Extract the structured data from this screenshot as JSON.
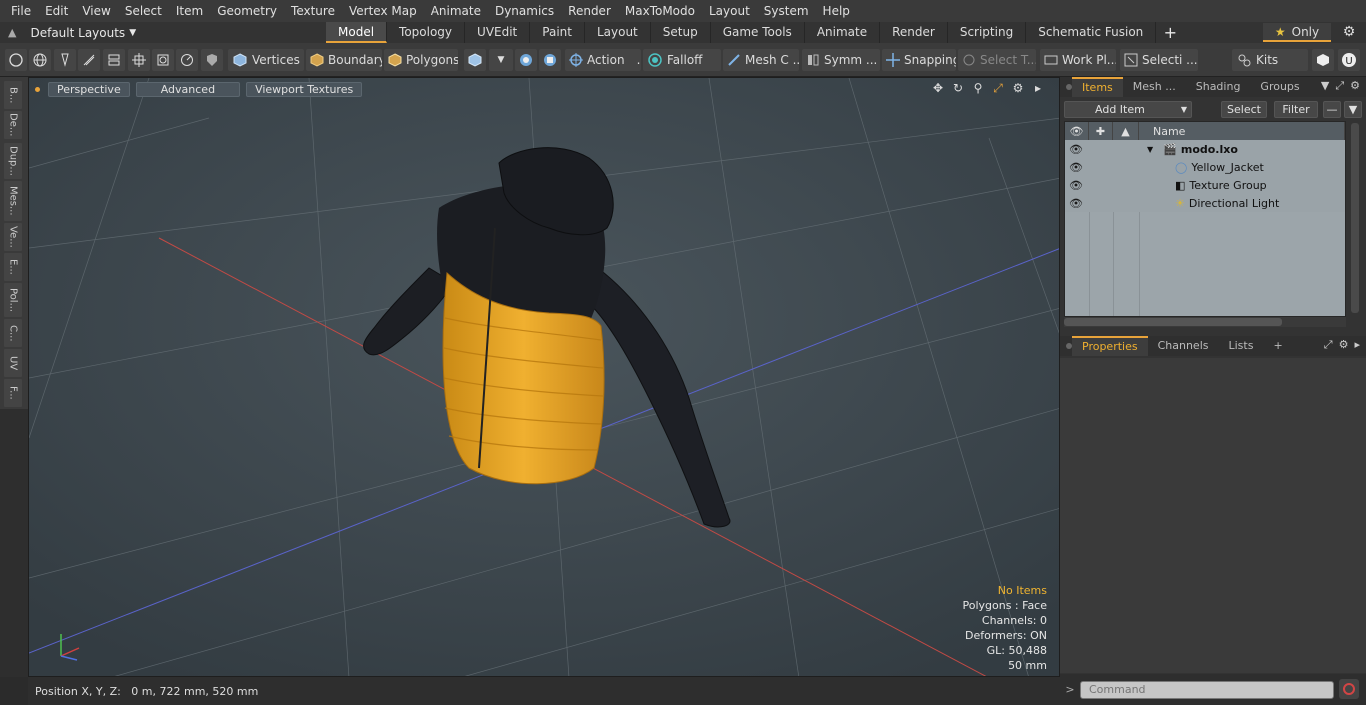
{
  "menu": [
    "File",
    "Edit",
    "View",
    "Select",
    "Item",
    "Geometry",
    "Texture",
    "Vertex Map",
    "Animate",
    "Dynamics",
    "Render",
    "MaxToModo",
    "Layout",
    "System",
    "Help"
  ],
  "layout_dropdown": "Default Layouts",
  "tabs": [
    "Model",
    "Topology",
    "UVEdit",
    "Paint",
    "Layout",
    "Setup",
    "Game Tools",
    "Animate",
    "Render",
    "Scripting",
    "Schematic Fusion"
  ],
  "active_tab": "Model",
  "only_label": "Only",
  "toolbar": {
    "vertices": "Vertices",
    "boundary": "Boundary",
    "polygons": "Polygons",
    "action": "Action",
    "falloff": "Falloff",
    "mesh": "Mesh C ...",
    "symm": "Symm ...",
    "snapping": "Snapping",
    "select_t": "Select T...",
    "work_pl": "Work Pl...",
    "selecti": "Selecti ...",
    "kits": "Kits"
  },
  "left_tabs": [
    "B...",
    "De...",
    "Dup...",
    "Mes...",
    "Ve...",
    "E...",
    "Pol...",
    "C...",
    "UV",
    "F..."
  ],
  "viewport": {
    "perspective": "Perspective",
    "advanced": "Advanced",
    "textures": "Viewport Textures",
    "info": {
      "selection": "No Items",
      "polygons": "Polygons : Face",
      "channels": "Channels: 0",
      "deformers": "Deformers: ON",
      "gl": "GL: 50,488",
      "scale": "50 mm"
    }
  },
  "status": "Position X, Y, Z:   0 m, 722 mm, 520 mm",
  "items_panel": {
    "tabs": [
      "Items",
      "Mesh ...",
      "Shading",
      "Groups"
    ],
    "add_item": "Add Item",
    "select": "Select",
    "filter": "Filter",
    "name_col": "Name",
    "tree": [
      {
        "label": "modo.lxo",
        "bold": true
      },
      {
        "label": "Yellow_Jacket",
        "bold": false
      },
      {
        "label": "Texture Group",
        "bold": false
      },
      {
        "label": "Directional Light",
        "bold": false
      }
    ]
  },
  "props_panel": {
    "tabs": [
      "Properties",
      "Channels",
      "Lists"
    ]
  },
  "command_placeholder": "Command",
  "colors": {
    "accent": "#e8a33a",
    "jacket_yellow": "#e8a526",
    "jacket_black": "#1d1f24"
  }
}
